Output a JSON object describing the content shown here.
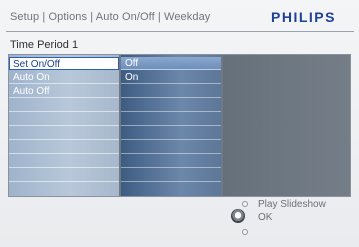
{
  "header": {
    "breadcrumb": "Setup | Options | Auto On/Off | Weekday",
    "brand": "PHILIPS"
  },
  "title": "Time Period 1",
  "menu": {
    "column1": [
      "Set On/Off",
      "Auto On",
      "Auto Off"
    ],
    "column2": [
      "Off",
      "On"
    ],
    "selected_column1": "Set On/Off",
    "selected_column2": "Off"
  },
  "footer": {
    "up_hint": "Play Slideshow",
    "ok_hint": "OK"
  },
  "colors": {
    "brand": "#1f3f99",
    "selection_border": "#2a5fb8"
  },
  "icons": [
    "nav-up-icon",
    "nav-knob-icon",
    "nav-down-icon"
  ]
}
